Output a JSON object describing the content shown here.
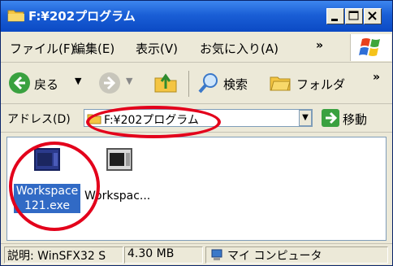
{
  "window": {
    "title": "F:¥202プログラム"
  },
  "menu": {
    "file": "ファイル(F)",
    "edit": "編集(E)",
    "view": "表示(V)",
    "favorites": "お気に入り(A)",
    "more": "»"
  },
  "toolbar": {
    "back": "戻る",
    "search": "検索",
    "folders": "フォルダ",
    "more": "»"
  },
  "address": {
    "label": "アドレス(D)",
    "value": "F:¥202プログラム",
    "go": "移動"
  },
  "files": [
    {
      "line1": "Workspace",
      "line2": "121.exe",
      "selected": true
    },
    {
      "line1": "Workspac...",
      "selected": false
    }
  ],
  "status": {
    "description": "説明: WinSFX32 S",
    "size": "4.30 MB",
    "location": "マイ コンピュータ"
  },
  "colors": {
    "titlebar": "#0b49c4",
    "selection": "#316ac5",
    "annotation": "#e3001b"
  }
}
